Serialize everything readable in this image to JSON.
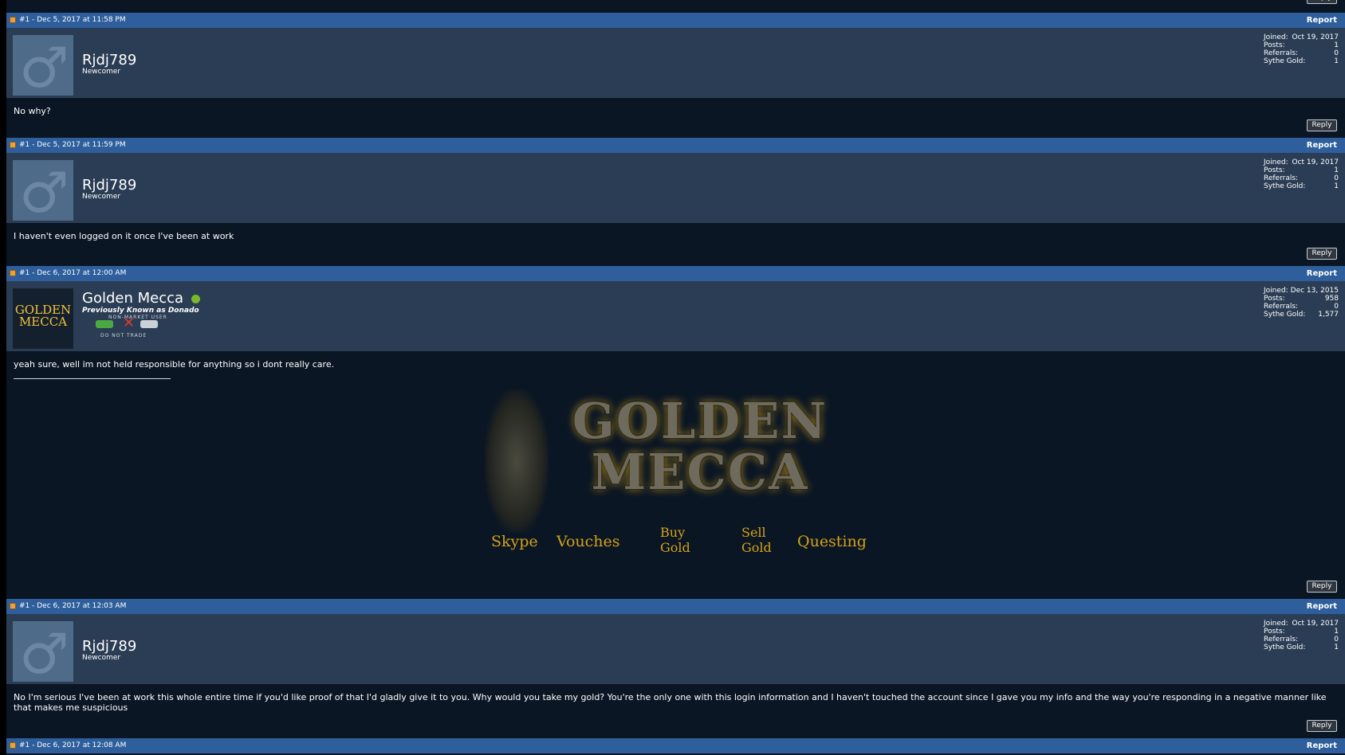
{
  "colors": {
    "page_bg": "#0b1624",
    "header_bar": "#2e5f9c",
    "user_bar": "#2b3d55",
    "online": "#7ab82b",
    "gold": "#d4a21a"
  },
  "common": {
    "report_label": "Report",
    "reply_label": "Reply",
    "stat_labels": {
      "joined": "Joined:",
      "posts": "Posts:",
      "referrals": "Referrals:",
      "gold": "Sythe Gold:"
    }
  },
  "posts": [
    {
      "header": "#1 - Dec 5, 2017 at 11:58 PM",
      "username": "Rjdj789",
      "user_title": "Newcomer",
      "avatar_icon": "male-icon",
      "joined": "Oct 19, 2017",
      "posts": "1",
      "referrals": "0",
      "gold": "1",
      "body": "No why?"
    },
    {
      "header": "#1 - Dec 5, 2017 at 11:59 PM",
      "username": "Rjdj789",
      "user_title": "Newcomer",
      "avatar_icon": "male-icon",
      "joined": "Oct 19, 2017",
      "posts": "1",
      "referrals": "0",
      "gold": "1",
      "body": "I haven't even logged on it once I've been at work"
    },
    {
      "header": "#1 - Dec 6, 2017 at 12:00 AM",
      "username": "Golden Mecca",
      "user_title": "Previously Known as Donado",
      "avatar_text": "GOLDEN MECCA",
      "badge_top": "NON-MARKET USER",
      "badge_bottom": "DO NOT TRADE",
      "joined": "Dec 13, 2015",
      "posts": "958",
      "referrals": "0",
      "gold": "1,577",
      "body": "yeah sure, well im not held responsible for anything so i dont really care.",
      "signature": {
        "banner_title": "GOLDEN MECCA",
        "links": [
          "Skype",
          "Vouches",
          "Buy Gold",
          "Sell Gold",
          "Questing"
        ]
      }
    },
    {
      "header": "#1 - Dec 6, 2017 at 12:03 AM",
      "username": "Rjdj789",
      "user_title": "Newcomer",
      "avatar_icon": "male-icon",
      "joined": "Oct 19, 2017",
      "posts": "1",
      "referrals": "0",
      "gold": "1",
      "body": "No I'm serious I've been at work this whole entire time if you'd like proof of that I'd gladly give it to you. Why would you take my gold? You're the only one with this login information and I haven't touched the account since I gave you my info and the way you're responding in a negative manner like that makes me suspicious"
    },
    {
      "header": "#1 - Dec 6, 2017 at 12:08 AM"
    }
  ]
}
